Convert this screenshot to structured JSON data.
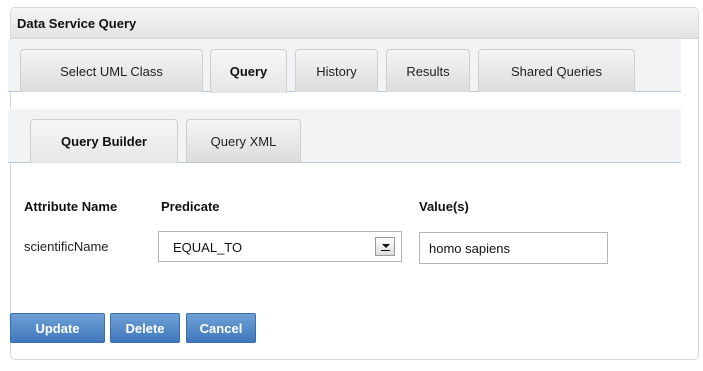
{
  "panel": {
    "title": "Data Service Query"
  },
  "main_tabs": [
    {
      "label": "Select UML Class"
    },
    {
      "label": "Query",
      "active": true
    },
    {
      "label": "History"
    },
    {
      "label": "Results"
    },
    {
      "label": "Shared Queries"
    }
  ],
  "sub_tabs": [
    {
      "label": "Query Builder",
      "active": true
    },
    {
      "label": "Query XML"
    }
  ],
  "form": {
    "attribute_name_header": "Attribute Name",
    "predicate_header": "Predicate",
    "values_header": "Value(s)",
    "attribute_name": "scientificName",
    "predicate_value": "EQUAL_TO",
    "value": "homo sapiens"
  },
  "buttons": {
    "update": "Update",
    "delete": "Delete",
    "cancel": "Cancel"
  },
  "colors": {
    "button_blue": "#4a82c6",
    "tab_underline": "#b9c8d8"
  }
}
